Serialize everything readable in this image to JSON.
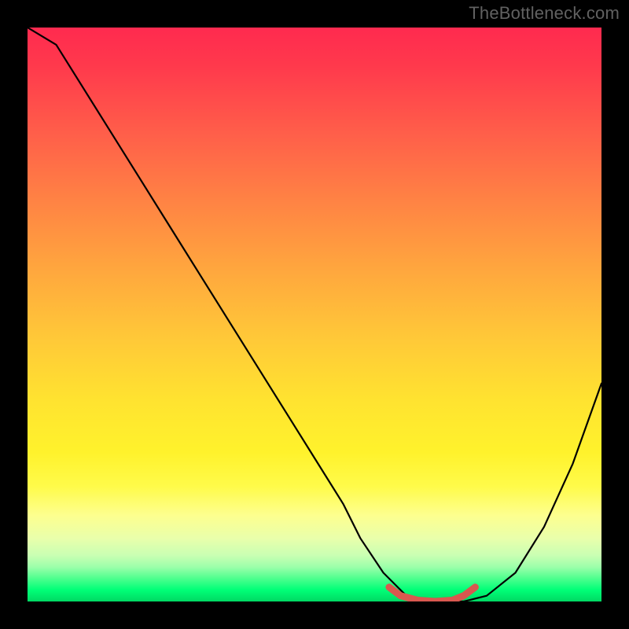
{
  "watermark": "TheBottleneck.com",
  "chart_data": {
    "type": "line",
    "title": "",
    "xlabel": "",
    "ylabel": "",
    "xlim": [
      0,
      100
    ],
    "ylim": [
      0,
      100
    ],
    "series": [
      {
        "name": "bottleneck-curve",
        "color": "#000000",
        "x": [
          0,
          5,
          10,
          15,
          20,
          25,
          30,
          35,
          40,
          45,
          50,
          55,
          58,
          62,
          66,
          70,
          73,
          76,
          80,
          85,
          90,
          95,
          100
        ],
        "values": [
          100,
          97,
          89,
          81,
          73,
          65,
          57,
          49,
          41,
          33,
          25,
          17,
          11,
          5,
          1,
          0,
          0,
          0,
          1,
          5,
          13,
          24,
          38
        ]
      },
      {
        "name": "optimal-range",
        "color": "#d9584f",
        "x": [
          63,
          65,
          68,
          71,
          74,
          76,
          78
        ],
        "values": [
          2.5,
          1.0,
          0.2,
          0.0,
          0.2,
          1.0,
          2.5
        ]
      }
    ],
    "gradient_stops": [
      {
        "pos": 0,
        "color": "#ff2a4f"
      },
      {
        "pos": 50,
        "color": "#ffc838"
      },
      {
        "pos": 80,
        "color": "#fffb4a"
      },
      {
        "pos": 100,
        "color": "#00d863"
      }
    ]
  }
}
